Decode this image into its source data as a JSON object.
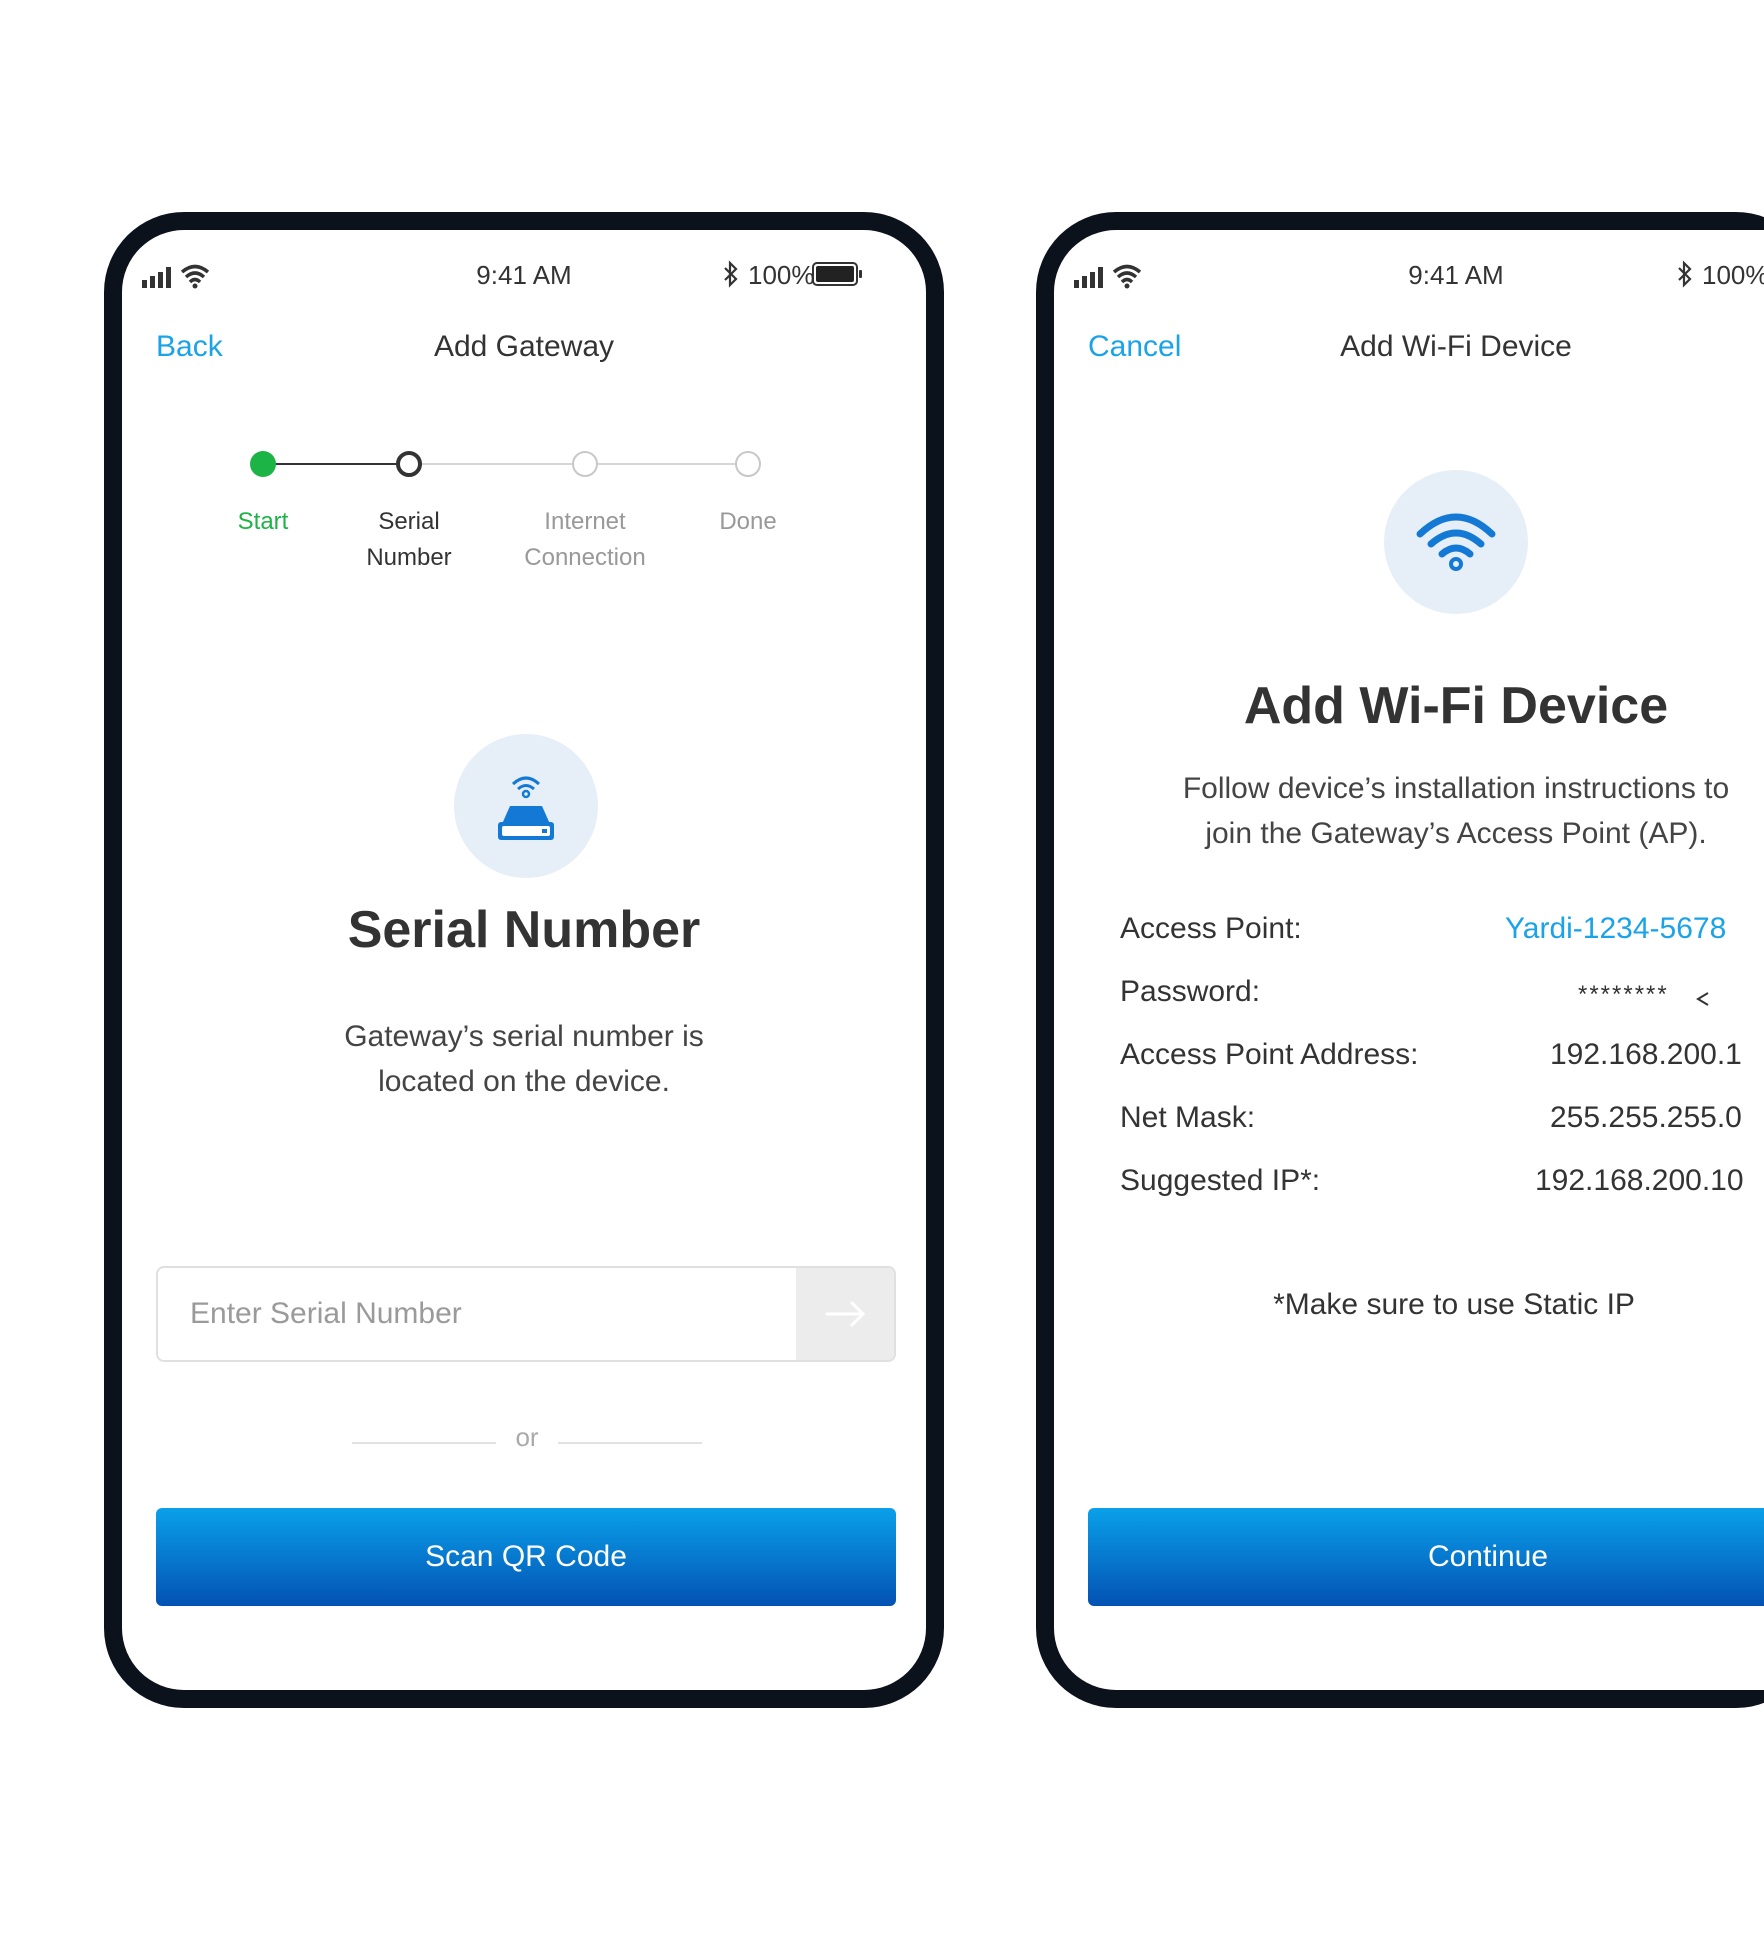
{
  "phone_left": {
    "status": {
      "time": "9:41 AM",
      "battery": "100%"
    },
    "nav": {
      "back_label": "Back",
      "title": "Add Gateway"
    },
    "stepper": {
      "steps": [
        {
          "label": "Start"
        },
        {
          "label": "Serial\nNumber"
        },
        {
          "label": "Internet\nConnection"
        },
        {
          "label": "Done"
        }
      ],
      "colors": {
        "done": "#1db446",
        "current": "#333333",
        "pending": "#c8c8c8"
      }
    },
    "heading": "Serial Number",
    "description_line1": "Gateway’s serial number is",
    "description_line2": "located on the device.",
    "serial_input": {
      "placeholder": "Enter Serial Number",
      "value": ""
    },
    "or_label": "or",
    "scan_button_label": "Scan QR Code"
  },
  "phone_right": {
    "status": {
      "time": "9:41 AM",
      "battery": "100%"
    },
    "nav": {
      "cancel_label": "Cancel",
      "title": "Add Wi-Fi Device"
    },
    "heading": "Add Wi-Fi Device",
    "description_line1": "Follow device’s installation instructions to",
    "description_line2": "join the Gateway’s Access Point (AP).",
    "info": [
      {
        "key": "Access Point:",
        "value": "Yardi-1234-5678"
      },
      {
        "key": "Password:",
        "value": "********"
      },
      {
        "key": "Access Point Address:",
        "value": "192.168.200.1"
      },
      {
        "key": "Net Mask:",
        "value": "255.255.255.0"
      },
      {
        "key": "Suggested IP*:",
        "value": "192.168.200.10"
      }
    ],
    "note": "*Make sure to use Static IP",
    "continue_label": "Continue"
  },
  "colors": {
    "accent": "#1aa3e8",
    "button_top": "#0aa0ea",
    "button_bottom": "#0352b3",
    "icon_blue": "#1479d4"
  }
}
